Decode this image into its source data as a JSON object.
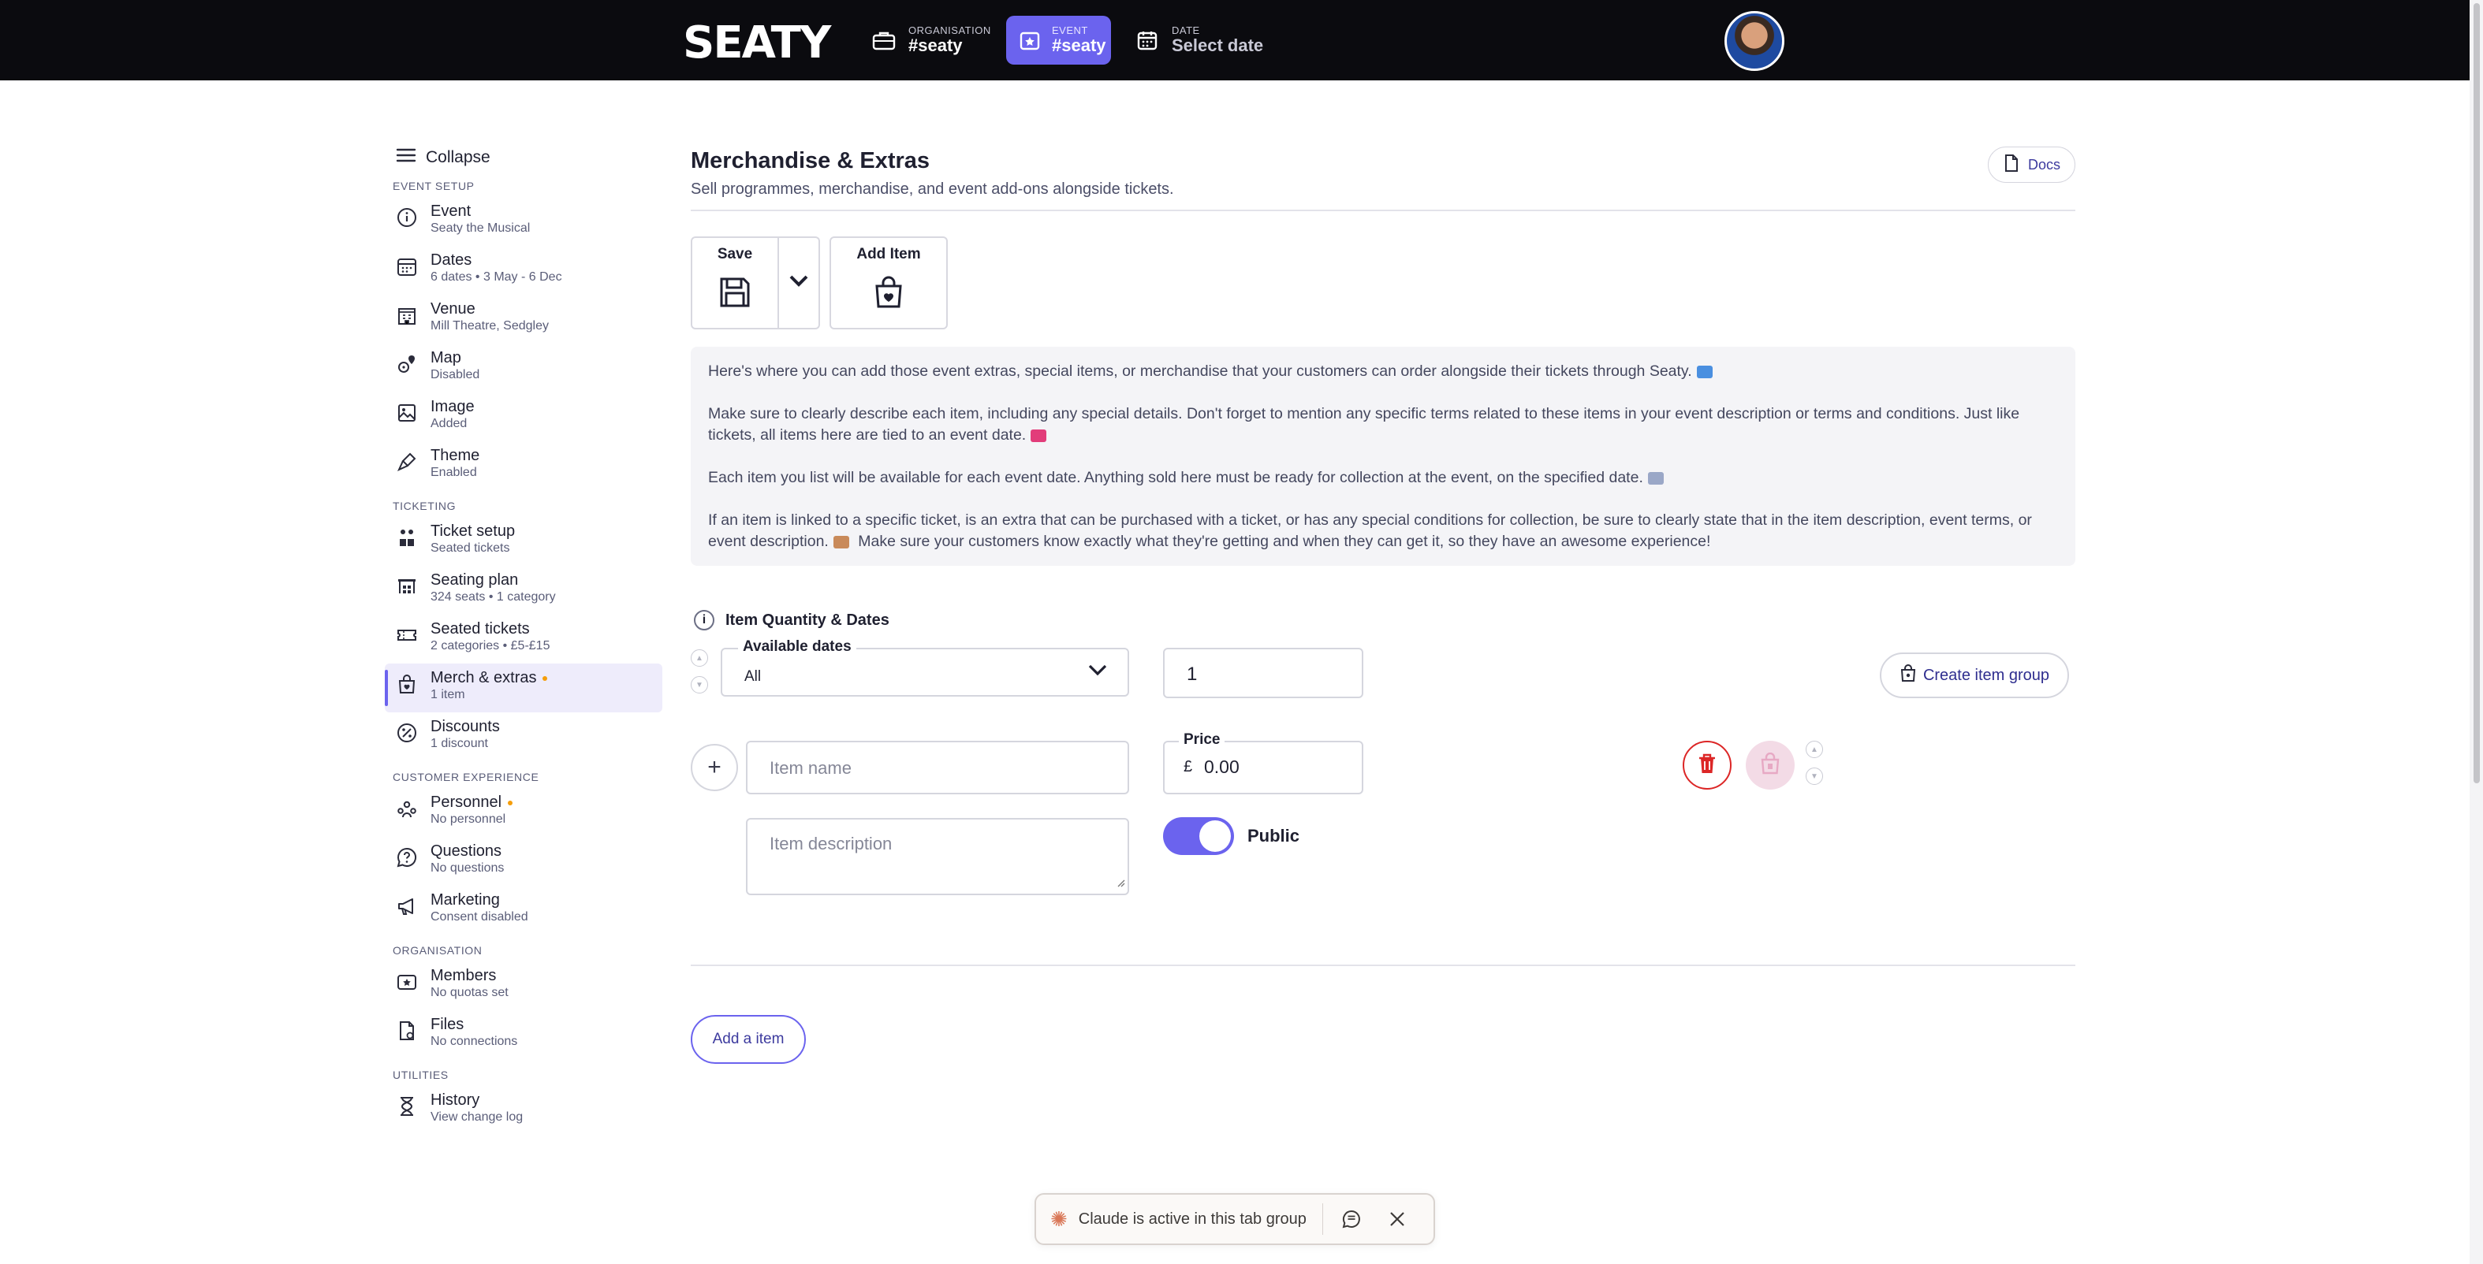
{
  "topbar": {
    "logo": "SEATY",
    "organisation_label": "ORGANISATION",
    "organisation_value": "#seaty",
    "event_label": "EVENT",
    "event_value": "#seaty",
    "date_label": "DATE",
    "date_value": "Select date"
  },
  "sidebar": {
    "collapse": "Collapse",
    "sections": {
      "event_setup": "EVENT SETUP",
      "ticketing": "TICKETING",
      "customer_experience": "CUSTOMER EXPERIENCE",
      "organisation": "ORGANISATION",
      "utilities": "UTILITIES"
    },
    "items": {
      "event": {
        "title": "Event",
        "sub": "Seaty the Musical",
        "icon": "info-icon"
      },
      "dates": {
        "title": "Dates",
        "sub": "6 dates • 3 May - 6 Dec",
        "icon": "calendar-icon"
      },
      "venue": {
        "title": "Venue",
        "sub": "Mill Theatre, Sedgley",
        "icon": "building-icon"
      },
      "map": {
        "title": "Map",
        "sub": "Disabled",
        "icon": "map-pin-icon"
      },
      "image": {
        "title": "Image",
        "sub": "Added",
        "icon": "image-icon"
      },
      "theme": {
        "title": "Theme",
        "sub": "Enabled",
        "icon": "brush-icon"
      },
      "ticket_setup": {
        "title": "Ticket setup",
        "sub": "Seated tickets",
        "icon": "people-icon"
      },
      "seating_plan": {
        "title": "Seating plan",
        "sub": "324 seats • 1 category",
        "icon": "theatre-icon"
      },
      "seated_tickets": {
        "title": "Seated tickets",
        "sub": "2 categories • £5-£15",
        "icon": "ticket-icon"
      },
      "merch": {
        "title": "Merch & extras",
        "sub": "1 item",
        "icon": "shopping-bag-icon"
      },
      "discounts": {
        "title": "Discounts",
        "sub": "1 discount",
        "icon": "percent-icon"
      },
      "personnel": {
        "title": "Personnel",
        "sub": "No personnel",
        "icon": "group-icon"
      },
      "questions": {
        "title": "Questions",
        "sub": "No questions",
        "icon": "question-icon"
      },
      "marketing": {
        "title": "Marketing",
        "sub": "Consent disabled",
        "icon": "megaphone-icon"
      },
      "members": {
        "title": "Members",
        "sub": "No quotas set",
        "icon": "member-card-icon"
      },
      "files": {
        "title": "Files",
        "sub": "No connections",
        "icon": "file-icon"
      },
      "history": {
        "title": "History",
        "sub": "View change log",
        "icon": "hourglass-icon"
      }
    }
  },
  "main": {
    "title": "Merchandise & Extras",
    "subtitle": "Sell programmes, merchandise, and event add-ons alongside tickets.",
    "docs": "Docs",
    "save": "Save",
    "add_item": "Add Item",
    "info": [
      "Here's where you can add those event extras, special items, or merchandise that your customers can order alongside their tickets through Seaty.",
      "Make sure to clearly describe each item, including any special details. Don't forget to mention any specific terms related to these items in your event description or terms and conditions. Just like tickets, all items here are tied to an event date.",
      "Each item you list will be available for each event date. Anything sold here must be ready for collection at the event, on the specified date.",
      "If an item is linked to a specific ticket, is an extra that can be purchased with a ticket, or has any special conditions for collection, be sure to clearly state that in the item description, event terms, or event description.",
      "Make sure your customers know exactly what they're getting and when they can get it, so they have an awesome experience!"
    ],
    "quantity_dates_heading": "Item Quantity & Dates",
    "available_dates_label": "Available dates",
    "available_dates_value": "All",
    "quantity_value": "1",
    "create_group": "Create item group",
    "item_name_placeholder": "Item name",
    "price_label": "Price",
    "currency": "£",
    "price_value": "0.00",
    "item_description_placeholder": "Item description",
    "public_label": "Public",
    "public_on": true,
    "add_a_item": "Add a item"
  },
  "claude_bar": {
    "text": "Claude is active in this tab group"
  },
  "colors": {
    "accent": "#6b63ee",
    "topbar": "#0b0b0f",
    "danger": "#dc2626"
  }
}
